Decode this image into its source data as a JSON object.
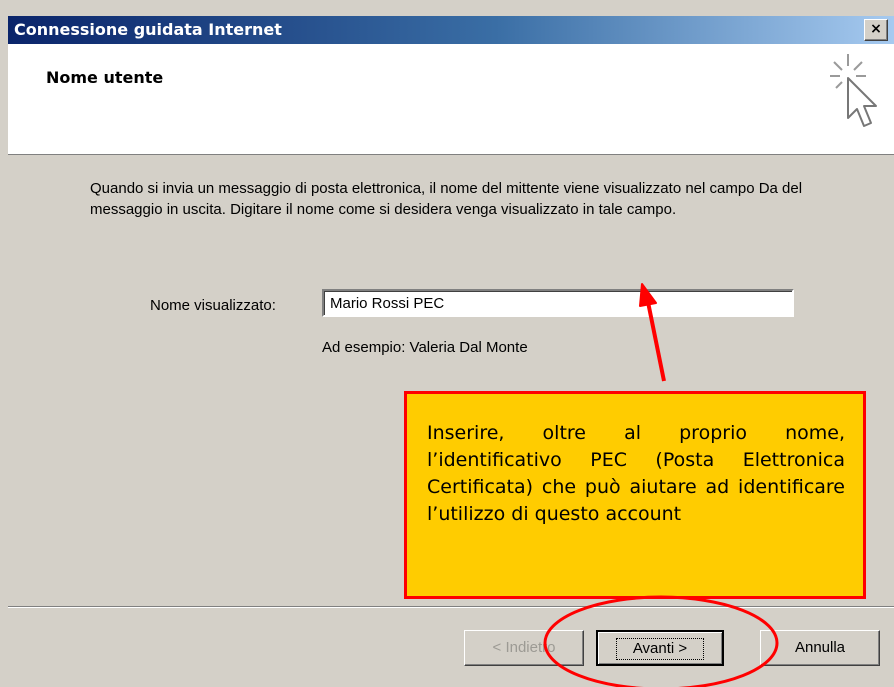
{
  "window": {
    "title": "Connessione guidata Internet",
    "close_symbol": "×"
  },
  "header": {
    "title": "Nome utente",
    "icon": "cursor-sparkle-icon"
  },
  "body": {
    "description": "Quando si invia un messaggio di posta elettronica, il nome del mittente viene visualizzato nel campo Da del messaggio in uscita. Digitare il nome come si desidera venga visualizzato in tale campo.",
    "field_label": "Nome visualizzato:",
    "field_value": "Mario Rossi PEC",
    "example": "Ad esempio: Valeria Dal Monte"
  },
  "callout": {
    "text": "Inserire, oltre al proprio nome, l’identificativo PEC (Posta Elettronica Certificata) che può aiutare ad identificare l’utilizzo di questo account"
  },
  "buttons": {
    "back": "< Indietro",
    "next": "Avanti >",
    "cancel": "Annulla"
  },
  "colors": {
    "titlebar": "#0a246a",
    "dialog_bg": "#d4d0c8",
    "callout_bg": "#ffcc00",
    "annotation": "#ff0000"
  }
}
